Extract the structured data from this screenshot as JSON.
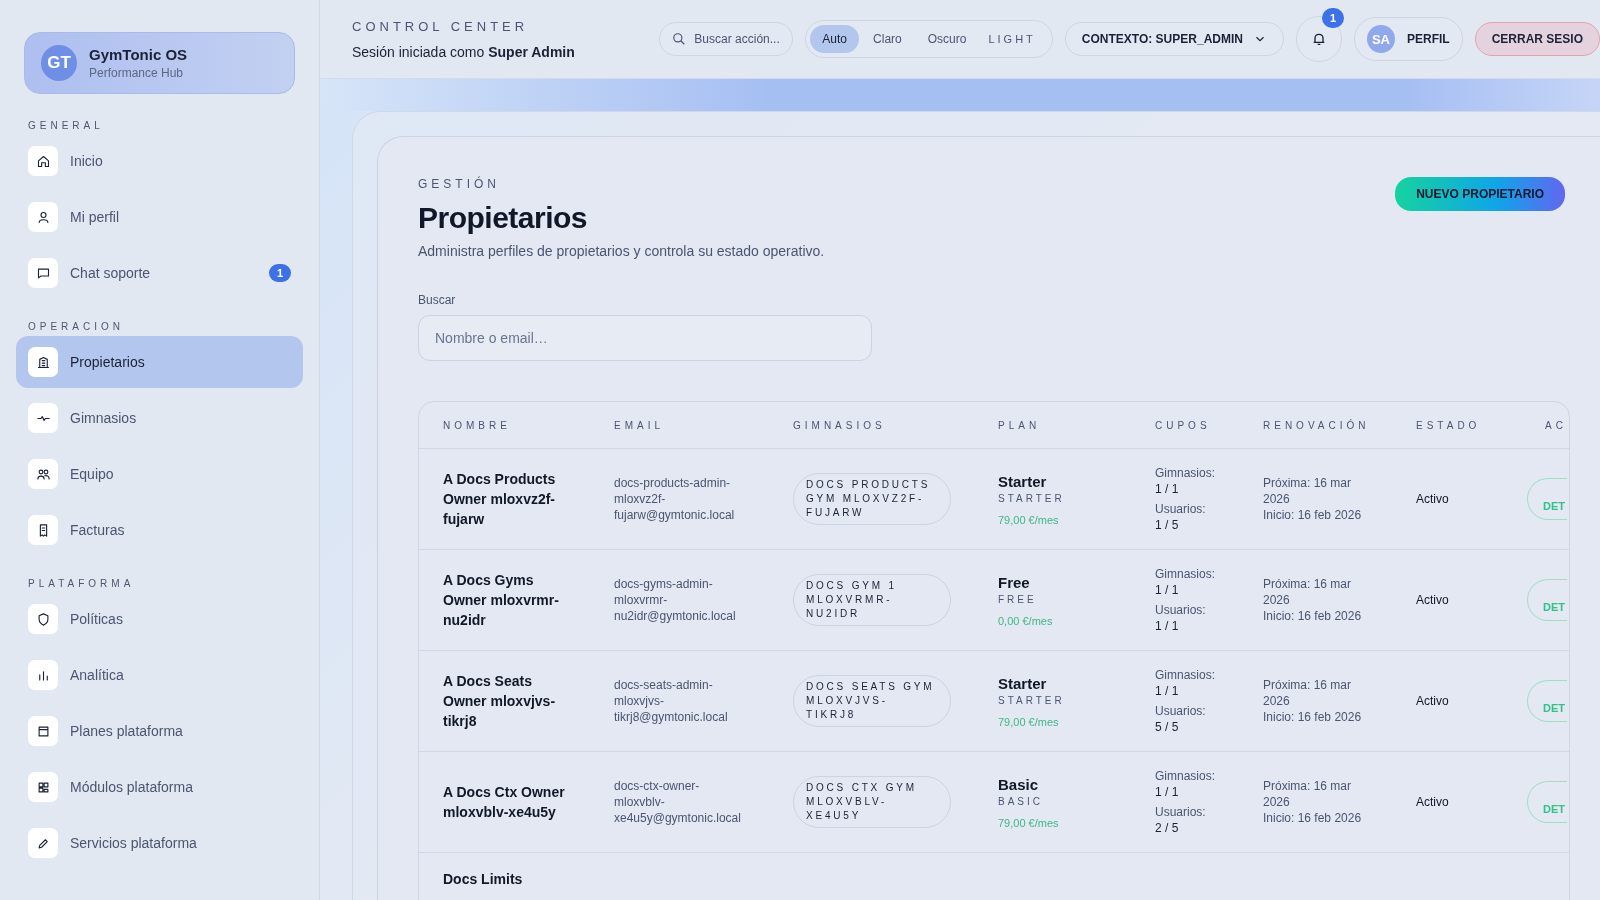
{
  "brand": {
    "initials": "GT",
    "name": "GymTonic OS",
    "subtitle": "Performance Hub"
  },
  "sidebar": {
    "sections": [
      {
        "title": "GENERAL",
        "items": [
          {
            "label": "Inicio",
            "kind": "home",
            "selected": false
          },
          {
            "label": "Mi perfil",
            "kind": "user",
            "selected": false
          },
          {
            "label": "Chat soporte",
            "kind": "chat",
            "selected": false,
            "badge": "1"
          }
        ]
      },
      {
        "title": "OPERACION",
        "items": [
          {
            "label": "Propietarios",
            "kind": "building",
            "selected": true
          },
          {
            "label": "Gimnasios",
            "kind": "pulse",
            "selected": false
          },
          {
            "label": "Equipo",
            "kind": "users",
            "selected": false
          },
          {
            "label": "Facturas",
            "kind": "receipt",
            "selected": false
          }
        ]
      },
      {
        "title": "PLATAFORMA",
        "items": [
          {
            "label": "Políticas",
            "kind": "shield",
            "selected": false
          },
          {
            "label": "Analítica",
            "kind": "bars",
            "selected": false
          },
          {
            "label": "Planes plataforma",
            "kind": "window",
            "selected": false
          },
          {
            "label": "Módulos plataforma",
            "kind": "modules",
            "selected": false
          },
          {
            "label": "Servicios plataforma",
            "kind": "pencil",
            "selected": false
          }
        ]
      }
    ]
  },
  "header": {
    "overline": "CONTROL CENTER",
    "session": "Sesión iniciada como **Super Admin**",
    "search": {
      "placeholder": "Buscar acción..."
    },
    "theme": {
      "options": [
        {
          "label": "Auto",
          "selected": true
        },
        {
          "label": "Claro",
          "selected": false
        },
        {
          "label": "Oscuro",
          "selected": false
        }
      ],
      "current": "LIGHT"
    },
    "context": "CONTEXTO: SUPER_ADMIN",
    "notifications": "1",
    "profile": {
      "initials": "SA",
      "label": "PERFIL"
    },
    "logout": "CERRAR SESIO"
  },
  "page": {
    "overline": "GESTIÓN",
    "title": "Propietarios",
    "description": "Administra perfiles de propietarios y controla su estado operativo.",
    "new_button": "NUEVO PROPIETARIO",
    "search": {
      "label": "Buscar",
      "placeholder": "Nombre o email…"
    }
  },
  "table": {
    "columns": [
      "NOMBRE",
      "EMAIL",
      "GIMNASIOS",
      "PLAN",
      "CUPOS",
      "RENOVACIÓN",
      "ESTADO",
      "AC"
    ],
    "rows": [
      {
        "name": "A Docs Products Owner mloxvz2f-fujarw",
        "email": "docs-products-admin-mloxvz2f-fujarw@gymtonic.local",
        "gym": "DOCS PRODUCTS GYM MLOXVZ2F-FUJARW",
        "plan": "Starter",
        "plan_code": "STARTER",
        "price": "79,00 €/mes",
        "gyms_label": "Gimnasios:",
        "gyms": "1 / 1",
        "users_label": "Usuarios:",
        "users": "1 / 5",
        "next": "Próxima: 16 mar 2026",
        "start": "Inicio: 16 feb 2026",
        "status": "Activo",
        "action": "DET"
      },
      {
        "name": "A Docs Gyms Owner mloxvrmr-nu2idr",
        "email": "docs-gyms-admin-mloxvrmr-nu2idr@gymtonic.local",
        "gym": "DOCS GYM 1 MLOXVRMR-NU2IDR",
        "plan": "Free",
        "plan_code": "FREE",
        "price": "0,00 €/mes",
        "gyms_label": "Gimnasios:",
        "gyms": "1 / 1",
        "users_label": "Usuarios:",
        "users": "1 / 1",
        "next": "Próxima: 16 mar 2026",
        "start": "Inicio: 16 feb 2026",
        "status": "Activo",
        "action": "DET"
      },
      {
        "name": "A Docs Seats Owner mloxvjvs-tikrj8",
        "email": "docs-seats-admin-mloxvjvs-tikrj8@gymtonic.local",
        "gym": "DOCS SEATS GYM MLOXVJVS-TIKRJ8",
        "plan": "Starter",
        "plan_code": "STARTER",
        "price": "79,00 €/mes",
        "gyms_label": "Gimnasios:",
        "gyms": "1 / 1",
        "users_label": "Usuarios:",
        "users": "5 / 5",
        "next": "Próxima: 16 mar 2026",
        "start": "Inicio: 16 feb 2026",
        "status": "Activo",
        "action": "DET"
      },
      {
        "name": "A Docs Ctx Owner mloxvblv-xe4u5y",
        "email": "docs-ctx-owner-mloxvblv-xe4u5y@gymtonic.local",
        "gym": "DOCS CTX GYM MLOXVBLV-XE4U5Y",
        "plan": "Basic",
        "plan_code": "BASIC",
        "price": "79,00 €/mes",
        "gyms_label": "Gimnasios:",
        "gyms": "1 / 1",
        "users_label": "Usuarios:",
        "users": "2 / 5",
        "next": "Próxima: 16 mar 2026",
        "start": "Inicio: 16 feb 2026",
        "status": "Activo",
        "action": "DET"
      },
      {
        "name": "Docs Limits"
      }
    ]
  }
}
